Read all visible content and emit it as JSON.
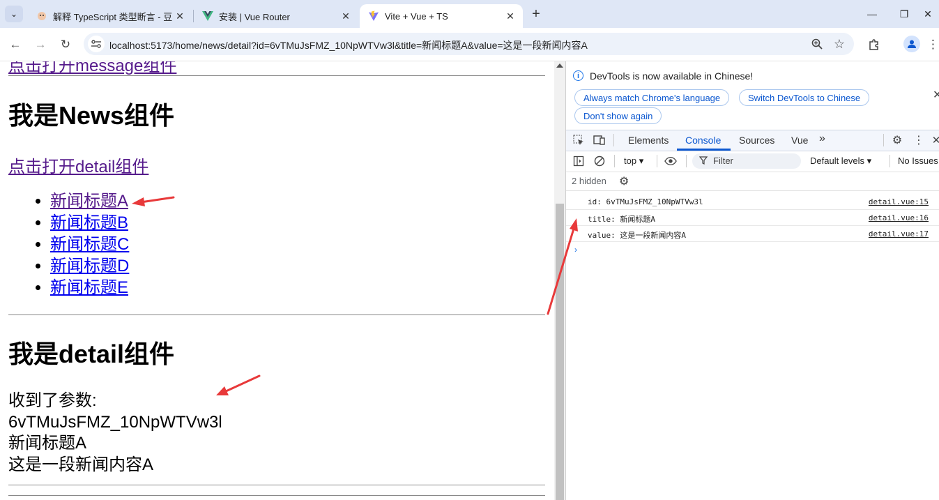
{
  "browser": {
    "tabs": [
      {
        "title": "解释 TypeScript 类型断言 - 豆",
        "active": false
      },
      {
        "title": "安装 | Vue Router",
        "active": false
      },
      {
        "title": "Vite + Vue + TS",
        "active": true
      }
    ],
    "url": "localhost:5173/home/news/detail?id=6vTMuJsFMZ_10NpWTVw3l&title=新闻标题A&value=这是一段新闻内容A"
  },
  "page": {
    "clipped_link": "点击打开message组件",
    "news_heading": "我是News组件",
    "detail_link": "点击打开detail组件",
    "news_items": [
      "新闻标题A",
      "新闻标题B",
      "新闻标题C",
      "新闻标题D",
      "新闻标题E"
    ],
    "detail_heading": "我是detail组件",
    "params_label": "收到了参数:",
    "param_id": "6vTMuJsFMZ_10NpWTVw3l",
    "param_title": "新闻标题A",
    "param_value": "这是一段新闻内容A"
  },
  "devtools": {
    "notice": "DevTools is now available in Chinese!",
    "buttons": [
      "Always match Chrome's language",
      "Switch DevTools to Chinese",
      "Don't show again"
    ],
    "tabs": [
      "Elements",
      "Console",
      "Sources",
      "Vue"
    ],
    "active_tab": "Console",
    "context": "top",
    "filter_placeholder": "Filter",
    "levels": "Default levels",
    "issues": "No Issues",
    "hidden": "2 hidden",
    "logs": [
      {
        "msg": "id: 6vTMuJsFMZ_10NpWTVw3l",
        "src": "detail.vue:15"
      },
      {
        "msg": "title: 新闻标题A",
        "src": "detail.vue:16"
      },
      {
        "msg": "value: 这是一段新闻内容A",
        "src": "detail.vue:17"
      }
    ]
  },
  "colors": {
    "accent": "#0b57d0",
    "arrow": "#e8393a",
    "link_visited": "#551a8b",
    "link": "#0000ee"
  }
}
